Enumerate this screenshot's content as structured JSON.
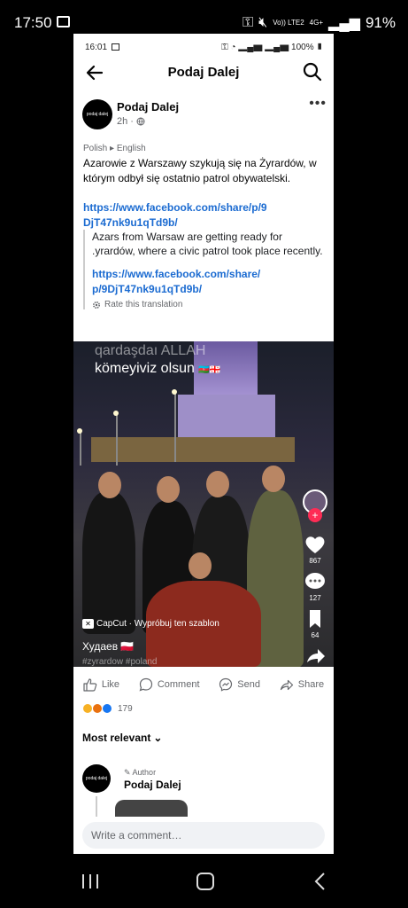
{
  "system": {
    "time": "17:50",
    "network": "Vo)) LTE2",
    "net2": "4G+",
    "battery": "91%"
  },
  "inner_status": {
    "time": "16:01",
    "battery": "100%"
  },
  "header": {
    "title": "Podaj Dalej",
    "back_icon": "arrow-left-icon",
    "search_icon": "search-icon"
  },
  "post": {
    "author": "Podaj Dalej",
    "avatar_text": "podaj dalej",
    "time": "2h",
    "lang_from": "Polish",
    "lang_to": "English",
    "text": "Azarowie z Warszawy szykują się na Żyrardów, w którym odbył się ostatnio patrol obywatelski.",
    "link": "https://www.facebook.com/share/p/9DjT47nk9u1qTd9b/",
    "translation": "Azars from Warsaw are getting ready for .yrardów, where a civic patrol took place recently.",
    "translation_link": "https://www.facebook.com/share/p/9DjT47nk9u1qTd9b/",
    "rate_label": "Rate this translation"
  },
  "video": {
    "caption_line1": "qardaşdaı ALLAH",
    "caption_line2": "kömeyiviz olsun",
    "likes": "867",
    "comments": "127",
    "saves": "64",
    "capcut_label": "CapCut · Wypróbuj ten szablon",
    "username": "Худаев",
    "hashtags": "#zyrardow #poland"
  },
  "actions": {
    "like": "Like",
    "comment": "Comment",
    "send": "Send",
    "share": "Share"
  },
  "reactions": {
    "count": "179",
    "colors": [
      "#f7b125",
      "#e9710f",
      "#1877f2"
    ]
  },
  "comments": {
    "sort_label": "Most relevant",
    "items": [
      {
        "author_tag": "Author",
        "name": "Podaj Dalej",
        "avatar_text": "podaj dalej"
      }
    ],
    "write_placeholder": "Write a comment…"
  }
}
